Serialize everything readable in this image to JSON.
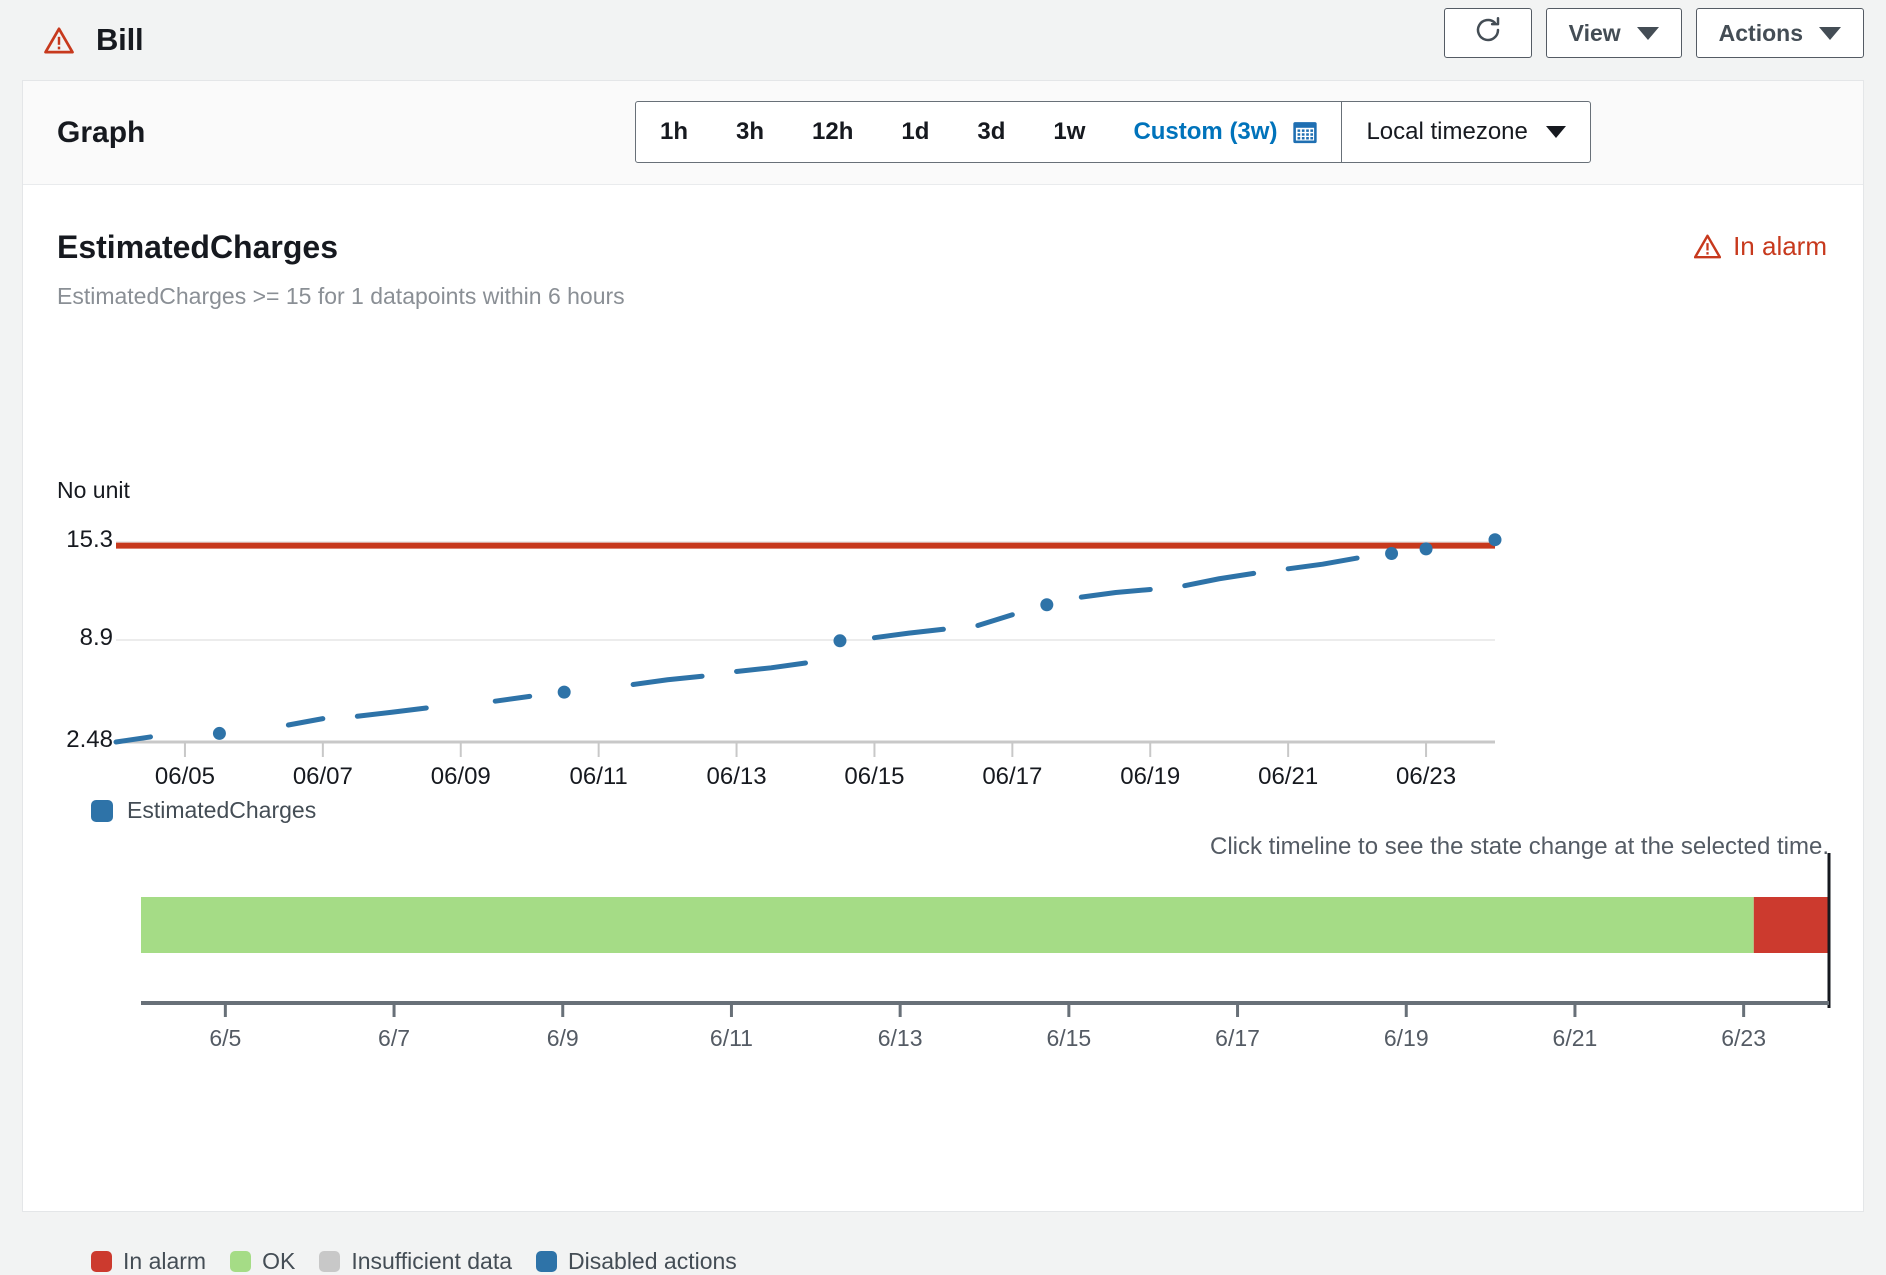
{
  "header": {
    "title": "Bill",
    "alarm_icon": "warning-triangle-icon",
    "refresh_icon": "refresh-icon",
    "view_label": "View",
    "actions_label": "Actions"
  },
  "graph_panel": {
    "title": "Graph",
    "ranges": [
      "1h",
      "3h",
      "12h",
      "1d",
      "3d",
      "1w"
    ],
    "custom_label": "Custom (3w)",
    "calendar_icon": "calendar-icon",
    "timezone_label": "Local timezone"
  },
  "alarm": {
    "metric_name": "EstimatedCharges",
    "condition": "EstimatedCharges >= 15 for 1 datapoints within 6 hours",
    "state_label": "In alarm",
    "state_icon": "warning-triangle-icon"
  },
  "timeline": {
    "hint": "Click timeline to see the state change at the selected time.",
    "xticks": [
      "6/5",
      "6/7",
      "6/9",
      "6/11",
      "6/13",
      "6/15",
      "6/17",
      "6/19",
      "6/21",
      "6/23"
    ],
    "segments": [
      {
        "state": "OK",
        "start_pct": 0,
        "end_pct": 95.6,
        "color": "#a5dc86"
      },
      {
        "state": "In alarm",
        "start_pct": 95.6,
        "end_pct": 100,
        "color": "#cc3a2e"
      }
    ],
    "legend": [
      {
        "label": "In alarm",
        "color": "#cc3a2e"
      },
      {
        "label": "OK",
        "color": "#a5dc86"
      },
      {
        "label": "Insufficient data",
        "color": "#c8c8c8"
      },
      {
        "label": "Disabled actions",
        "color": "#2e73a8"
      }
    ]
  },
  "chart_data": {
    "type": "line",
    "title": "EstimatedCharges",
    "xlabel": "",
    "ylabel": "No unit",
    "unit_label": "No unit",
    "yticks": [
      2.48,
      8.9,
      15.3
    ],
    "ylim": [
      2.48,
      15.85
    ],
    "xticks": [
      "06/05",
      "06/07",
      "06/09",
      "06/11",
      "06/13",
      "06/15",
      "06/17",
      "06/19",
      "06/21",
      "06/23"
    ],
    "xlim": [
      "06/04",
      "06/24"
    ],
    "grid": true,
    "legend": [
      "EstimatedCharges"
    ],
    "series_color": "#2e73a8",
    "threshold": {
      "value": 15,
      "color": "#c7391d",
      "label": "EstimatedCharges >= 15"
    },
    "series": [
      {
        "name": "EstimatedCharges",
        "x": [
          "06/04",
          "06/04.4",
          "06/05",
          "06/05.6",
          "06/06.3",
          "06/06.9",
          "06/07.3",
          "06/07.8",
          "06/08.3",
          "06/08.8",
          "06/09.3",
          "06/09.8",
          "06/10.3",
          "06/10.8",
          "06/11.3",
          "06/11.8",
          "06/12.3",
          "06/12.8",
          "06/13.3",
          "06/13.8",
          "06/14.3",
          "06/14.9",
          "06/15.4",
          "06/15.9",
          "06/16.4",
          "06/16.9",
          "06/17.4",
          "06/17.9",
          "06/18.4",
          "06/18.9",
          "06/19.4",
          "06/19.9",
          "06/20.4",
          "06/20.9",
          "06/21.4",
          "06/21.9",
          "06/22.4",
          "06/22.9",
          "06/23.3",
          "06/23.7",
          "06/24"
        ],
        "values": [
          2.48,
          2.8,
          2.92,
          3.02,
          3.3,
          3.55,
          3.95,
          4.1,
          4.35,
          4.62,
          4.85,
          5.05,
          5.35,
          5.62,
          5.85,
          6.1,
          6.4,
          6.62,
          6.92,
          7.15,
          7.45,
          8.85,
          9.05,
          9.35,
          9.6,
          9.85,
          10.55,
          11.2,
          11.7,
          12.0,
          12.2,
          12.45,
          12.9,
          13.25,
          13.55,
          13.85,
          14.25,
          14.55,
          14.85,
          15.0,
          15.45
        ]
      }
    ]
  }
}
